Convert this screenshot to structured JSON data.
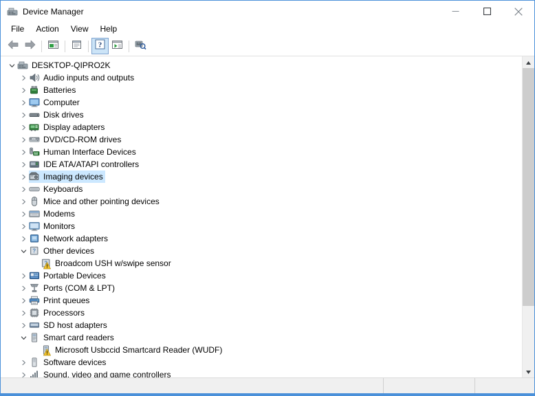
{
  "window": {
    "title": "Device Manager",
    "app_icon": "device-manager-icon",
    "accent_color": "#4a90d9",
    "buttons": [
      {
        "name": "minimize",
        "glyph": "minimize-icon",
        "label": "Minimize"
      },
      {
        "name": "maximize",
        "glyph": "maximize-icon",
        "label": "Maximize"
      },
      {
        "name": "close",
        "glyph": "close-icon",
        "label": "Close"
      }
    ]
  },
  "menubar": {
    "items": [
      {
        "label": "File"
      },
      {
        "label": "Action"
      },
      {
        "label": "View"
      },
      {
        "label": "Help"
      }
    ]
  },
  "toolbar": {
    "items": [
      {
        "name": "back-button",
        "icon": "back-arrow-icon",
        "selected": false
      },
      {
        "name": "forward-button",
        "icon": "forward-arrow-icon",
        "selected": false
      },
      {
        "name": "separator-1",
        "icon": "separator",
        "selected": false
      },
      {
        "name": "show-hide-console-tree-button",
        "icon": "console-tree-icon",
        "selected": false
      },
      {
        "name": "separator-2",
        "icon": "separator",
        "selected": false
      },
      {
        "name": "properties-button",
        "icon": "properties-icon",
        "selected": false
      },
      {
        "name": "separator-3",
        "icon": "separator",
        "selected": false
      },
      {
        "name": "help-button",
        "icon": "help-icon",
        "selected": true
      },
      {
        "name": "update-driver-button",
        "icon": "update-driver-icon",
        "selected": false
      },
      {
        "name": "separator-4",
        "icon": "separator",
        "selected": false
      },
      {
        "name": "scan-for-hardware-changes-button",
        "icon": "scan-hardware-icon",
        "selected": false
      }
    ]
  },
  "tree": {
    "selected_label": "Imaging devices",
    "selection_color": "#cce8ff",
    "nodes": [
      {
        "label": "DESKTOP-QIPRO2K",
        "depth": 0,
        "twisty": "expanded",
        "icon": "computer-tower-icon",
        "warning": false,
        "selected": false
      },
      {
        "label": "Audio inputs and outputs",
        "depth": 1,
        "twisty": "collapsed",
        "icon": "speaker-icon",
        "warning": false,
        "selected": false
      },
      {
        "label": "Batteries",
        "depth": 1,
        "twisty": "collapsed",
        "icon": "battery-icon",
        "warning": false,
        "selected": false
      },
      {
        "label": "Computer",
        "depth": 1,
        "twisty": "collapsed",
        "icon": "monitor-icon",
        "warning": false,
        "selected": false
      },
      {
        "label": "Disk drives",
        "depth": 1,
        "twisty": "collapsed",
        "icon": "disk-drive-icon",
        "warning": false,
        "selected": false
      },
      {
        "label": "Display adapters",
        "depth": 1,
        "twisty": "collapsed",
        "icon": "display-adapter-icon",
        "warning": false,
        "selected": false
      },
      {
        "label": "DVD/CD-ROM drives",
        "depth": 1,
        "twisty": "collapsed",
        "icon": "optical-drive-icon",
        "warning": false,
        "selected": false
      },
      {
        "label": "Human Interface Devices",
        "depth": 1,
        "twisty": "collapsed",
        "icon": "hid-icon",
        "warning": false,
        "selected": false
      },
      {
        "label": "IDE ATA/ATAPI controllers",
        "depth": 1,
        "twisty": "collapsed",
        "icon": "ide-controller-icon",
        "warning": false,
        "selected": false
      },
      {
        "label": "Imaging devices",
        "depth": 1,
        "twisty": "collapsed",
        "icon": "camera-icon",
        "warning": false,
        "selected": true
      },
      {
        "label": "Keyboards",
        "depth": 1,
        "twisty": "collapsed",
        "icon": "keyboard-icon",
        "warning": false,
        "selected": false
      },
      {
        "label": "Mice and other pointing devices",
        "depth": 1,
        "twisty": "collapsed",
        "icon": "mouse-icon",
        "warning": false,
        "selected": false
      },
      {
        "label": "Modems",
        "depth": 1,
        "twisty": "collapsed",
        "icon": "modem-icon",
        "warning": false,
        "selected": false
      },
      {
        "label": "Monitors",
        "depth": 1,
        "twisty": "collapsed",
        "icon": "monitor-screen-icon",
        "warning": false,
        "selected": false
      },
      {
        "label": "Network adapters",
        "depth": 1,
        "twisty": "collapsed",
        "icon": "network-adapter-icon",
        "warning": false,
        "selected": false
      },
      {
        "label": "Other devices",
        "depth": 1,
        "twisty": "expanded",
        "icon": "unknown-device-icon",
        "warning": false,
        "selected": false
      },
      {
        "label": "Broadcom USH w/swipe sensor",
        "depth": 2,
        "twisty": "none",
        "icon": "unknown-device-icon",
        "warning": true,
        "selected": false
      },
      {
        "label": "Portable Devices",
        "depth": 1,
        "twisty": "collapsed",
        "icon": "portable-device-icon",
        "warning": false,
        "selected": false
      },
      {
        "label": "Ports (COM & LPT)",
        "depth": 1,
        "twisty": "collapsed",
        "icon": "port-icon",
        "warning": false,
        "selected": false
      },
      {
        "label": "Print queues",
        "depth": 1,
        "twisty": "collapsed",
        "icon": "printer-icon",
        "warning": false,
        "selected": false
      },
      {
        "label": "Processors",
        "depth": 1,
        "twisty": "collapsed",
        "icon": "processor-icon",
        "warning": false,
        "selected": false
      },
      {
        "label": "SD host adapters",
        "depth": 1,
        "twisty": "collapsed",
        "icon": "sd-adapter-icon",
        "warning": false,
        "selected": false
      },
      {
        "label": "Smart card readers",
        "depth": 1,
        "twisty": "expanded",
        "icon": "smartcard-reader-icon",
        "warning": false,
        "selected": false
      },
      {
        "label": "Microsoft Usbccid Smartcard Reader (WUDF)",
        "depth": 2,
        "twisty": "none",
        "icon": "smartcard-device-icon",
        "warning": true,
        "selected": false
      },
      {
        "label": "Software devices",
        "depth": 1,
        "twisty": "collapsed",
        "icon": "software-device-icon",
        "warning": false,
        "selected": false
      },
      {
        "label": "Sound, video and game controllers",
        "depth": 1,
        "twisty": "collapsed",
        "icon": "sound-controller-icon",
        "warning": false,
        "selected": false
      }
    ]
  },
  "scrollbar": {
    "up_arrow": "scroll-up-icon",
    "down_arrow": "scroll-down-icon",
    "thumb_position_percent": 0,
    "thumb_size_percent": 80
  },
  "statusbar": {
    "main_text": "",
    "mid_text": "",
    "end_text": ""
  }
}
